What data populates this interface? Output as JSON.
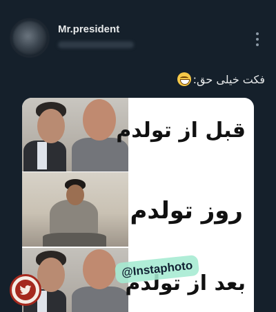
{
  "post": {
    "username": "Mr.president",
    "caption": "فکت خیلی حق:"
  },
  "meme": {
    "line_before": "قبل از تولدم",
    "line_day": "روز تولدم",
    "line_after": "بعد از تولدم",
    "watermark": "@Instaphoto"
  },
  "icons": {
    "more": "more-vertical-icon",
    "emoji": "grinning-sweat-emoji-icon",
    "badge": "bird-badge-icon"
  },
  "colors": {
    "background": "#15202b",
    "username": "#e7e9ea",
    "badge_red": "#a5291e"
  }
}
